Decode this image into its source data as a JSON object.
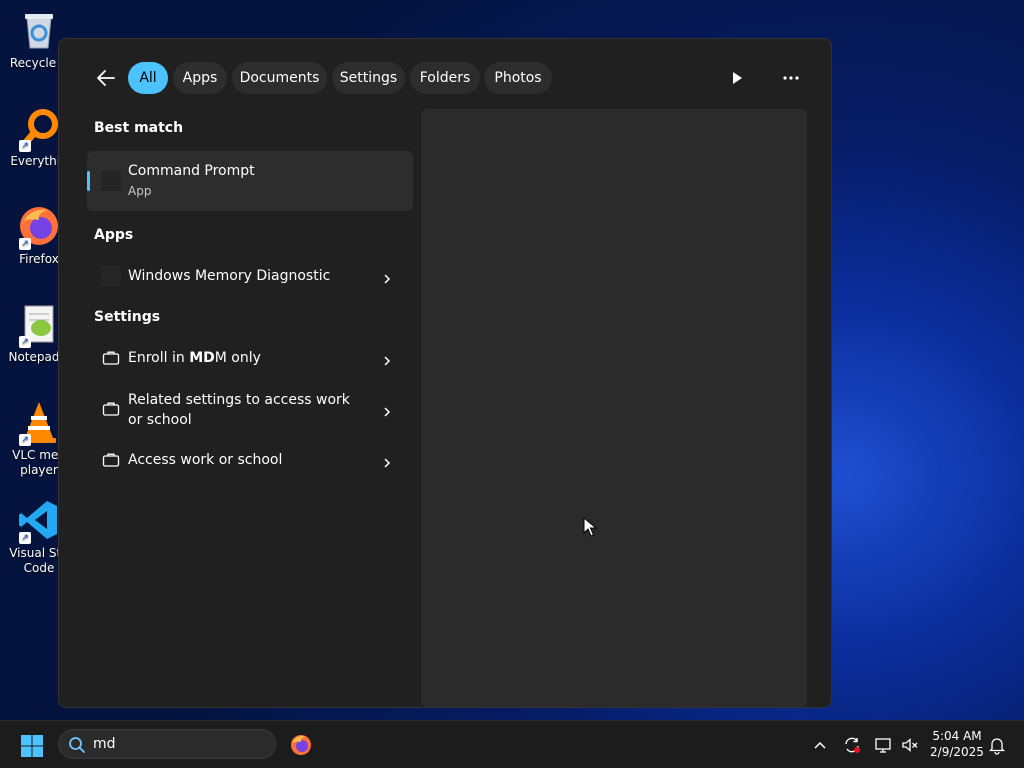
{
  "desktop": {
    "icons": [
      {
        "label": "Recycle B",
        "icon": "recycle-bin-icon"
      },
      {
        "label": "Everythin",
        "icon": "everything-icon"
      },
      {
        "label": "Firefox",
        "icon": "firefox-icon"
      },
      {
        "label": "Notepad+",
        "icon": "notepad-plus-icon"
      },
      {
        "label": "VLC med\nplayer",
        "icon": "vlc-icon"
      },
      {
        "label": "Visual Stu\nCode",
        "icon": "vscode-icon"
      }
    ]
  },
  "search_panel": {
    "filters": [
      {
        "label": "All",
        "active": true
      },
      {
        "label": "Apps"
      },
      {
        "label": "Documents"
      },
      {
        "label": "Settings"
      },
      {
        "label": "Folders"
      },
      {
        "label": "Photos"
      }
    ],
    "sections": {
      "best_match": "Best match",
      "apps": "Apps",
      "settings": "Settings"
    },
    "best_match": {
      "title": "Command Prompt",
      "subtitle": "App"
    },
    "apps": [
      {
        "title": "Windows Memory Diagnostic"
      }
    ],
    "settings": [
      {
        "title_pre": "Enroll in ",
        "title_bold": "MD",
        "title_post": "M only",
        "icon": "briefcase-icon"
      },
      {
        "title": "Related settings to access work or school",
        "icon": "briefcase-icon"
      },
      {
        "title": "Access work or school",
        "icon": "briefcase-icon"
      }
    ]
  },
  "taskbar": {
    "search_value": "md",
    "time": "5:04 AM",
    "date": "2/9/2025"
  },
  "colors": {
    "accent": "#4cc2ff",
    "panel_bg": "#202020",
    "preview_bg": "#2b2b2b"
  }
}
